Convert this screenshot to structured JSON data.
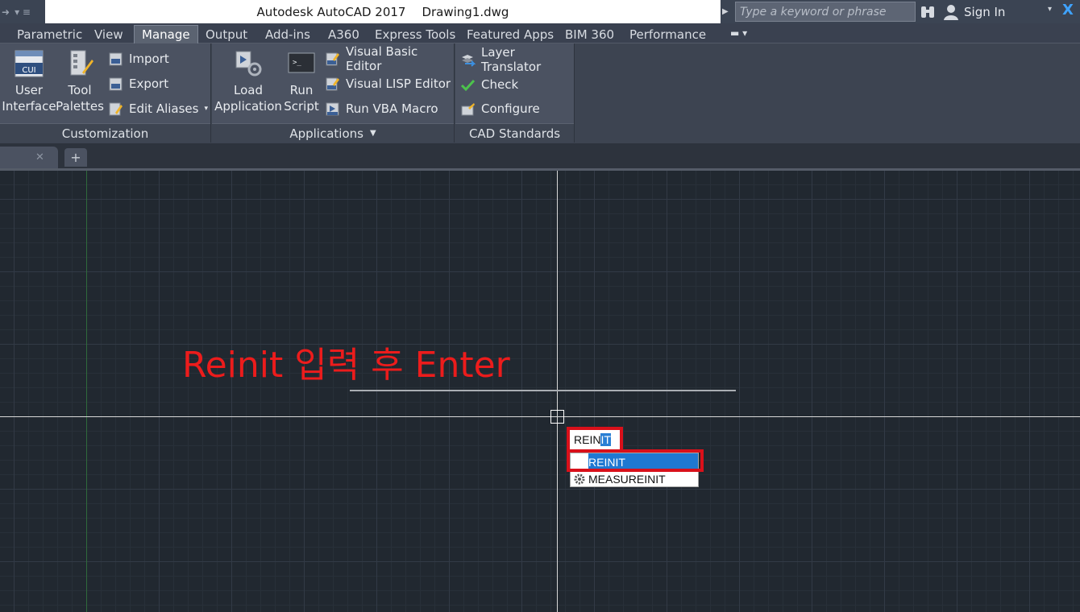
{
  "app": {
    "title": "Autodesk AutoCAD 2017",
    "document": "Drawing1.dwg",
    "search_placeholder": "Type a keyword or phrase",
    "signin_label": "Sign In"
  },
  "ribbon_tabs": [
    {
      "label": "Parametric",
      "active": false
    },
    {
      "label": "View",
      "active": false
    },
    {
      "label": "Manage",
      "active": true
    },
    {
      "label": "Output",
      "active": false
    },
    {
      "label": "Add-ins",
      "active": false
    },
    {
      "label": "A360",
      "active": false
    },
    {
      "label": "Express Tools",
      "active": false
    },
    {
      "label": "Featured Apps",
      "active": false
    },
    {
      "label": "BIM 360",
      "active": false
    },
    {
      "label": "Performance",
      "active": false
    }
  ],
  "panels": {
    "customization": {
      "title": "Customization",
      "user_interface": [
        "User",
        "Interface"
      ],
      "tool_palettes": [
        "Tool",
        "Palettes"
      ],
      "import": "Import",
      "export": "Export",
      "edit_aliases": "Edit Aliases",
      "cui_badge": "CUI"
    },
    "applications": {
      "title": "Applications",
      "load_application": [
        "Load",
        "Application"
      ],
      "run_script": [
        "Run",
        "Script"
      ],
      "visual_basic_editor": "Visual Basic Editor",
      "visual_lisp_editor": "Visual LISP Editor",
      "run_vba_macro": "Run VBA Macro"
    },
    "cad_standards": {
      "title": "CAD Standards",
      "layer_translator": "Layer Translator",
      "check": "Check",
      "configure": "Configure"
    }
  },
  "canvas": {
    "annotation": "Reinit 입력 후 Enter",
    "command_typed": "REIN",
    "command_autocomplete": "IT",
    "suggestions": [
      "REINIT",
      "MEASUREINIT"
    ]
  },
  "colors": {
    "annotation": "#ec1c1c",
    "highlight_border": "#d9101a",
    "selection": "#1f78d1"
  }
}
